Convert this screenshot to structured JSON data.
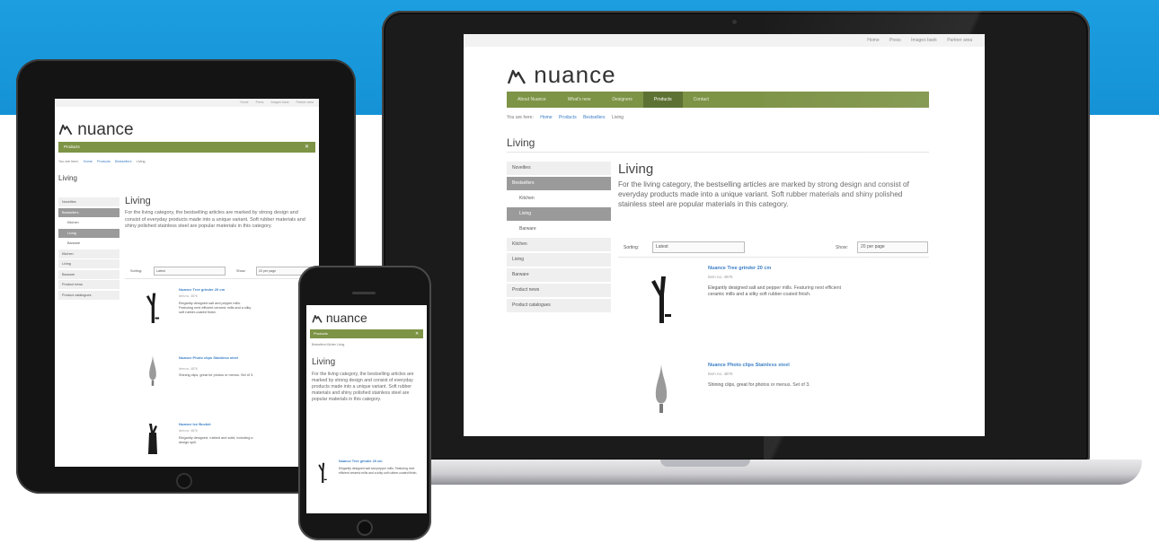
{
  "colors": {
    "band": "#1592d6",
    "nav_green": "#7d9346",
    "nav_active": "#5d7232",
    "link_blue": "#3a7ec6"
  },
  "site": {
    "logo": "nuance",
    "top_links": [
      "Home",
      "Press",
      "Images bank",
      "Partner area"
    ],
    "nav": [
      "About Nuance",
      "What's new",
      "Designers",
      "Products",
      "Contact"
    ],
    "nav_active_index": 3,
    "breadcrumb": {
      "prefix": "You are here:",
      "items": [
        "Home",
        "Products",
        "Bestsellers",
        "Living"
      ]
    },
    "page_heading": "Living",
    "sidebar": [
      {
        "label": "Novelties",
        "type": "item"
      },
      {
        "label": "Bestsellers",
        "type": "selected"
      },
      {
        "label": "Kitchen",
        "type": "sub"
      },
      {
        "label": "Living",
        "type": "subselected"
      },
      {
        "label": "Barware",
        "type": "sub"
      },
      {
        "label": "Kitchen",
        "type": "item"
      },
      {
        "label": "Living",
        "type": "item"
      },
      {
        "label": "Barware",
        "type": "item"
      },
      {
        "label": "Product news",
        "type": "item"
      },
      {
        "label": "Product catalogues",
        "type": "item"
      }
    ],
    "content_title": "Living",
    "description": "For the living category, the bestselling articles are marked by strong design and consist of everyday products made into a unique variant. Soft rubber materials and shiny polished stainless steel are popular materials in this category.",
    "sorting_label": "Sorting:",
    "sorting_value": "Latest",
    "show_label": "Show:",
    "show_value": "20 per page",
    "products": [
      {
        "icon": "tree-grinder-icon",
        "title": "Nuance Tree grinder 20 cm",
        "number": "Item no. 4876",
        "description": "Elegantly designed salt and pepper mills. Featuring next efficient ceramic mills and a silky soft rubber-coated finish."
      },
      {
        "icon": "drop-stopper-icon",
        "title": "Nuance Photo clips Stainless steel",
        "number": "Item no. 4876",
        "description": "Shining clips, great for photos or menus. Set of 3."
      },
      {
        "icon": "ice-bucket-icon",
        "title": "Nuance Ice Bucket",
        "number": "Item no. 4876",
        "description": "Elegantly designed, rubbed and solid, including a design spill."
      }
    ]
  },
  "phone": {
    "nav_label": "Products",
    "crumb": "Bestsellers   Kitchen   Living",
    "product_title": "Nuance Tree grinder 20 cm",
    "product_desc": "Elegantly designed salt and pepper mills. Featuring next efficient ceramic mills and a silky soft rubber-coated finish."
  },
  "tablet": {
    "nav_label": "Products"
  }
}
